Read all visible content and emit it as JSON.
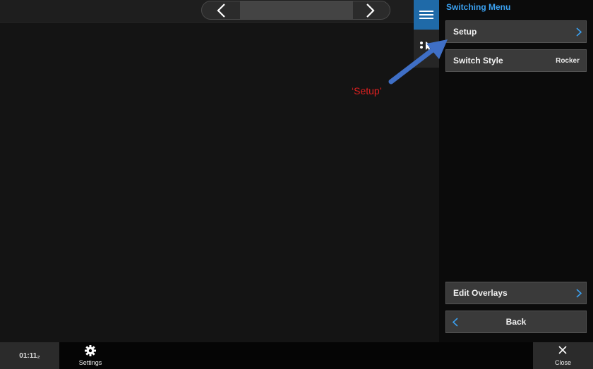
{
  "panel": {
    "title": "Switching Menu",
    "setup_label": "Setup",
    "switch_style_label": "Switch Style",
    "switch_style_value": "Rocker",
    "edit_overlays_label": "Edit Overlays",
    "back_label": "Back"
  },
  "bottom": {
    "clock": "01:11₂",
    "settings_label": "Settings",
    "close_label": "Close"
  },
  "annotation": {
    "label": "‘Setup’"
  },
  "colors": {
    "accent": "#3aa0f0",
    "tab_active": "#1f6aa8",
    "annotation_text": "#e02020",
    "annotation_arrow": "#3f6fc6"
  }
}
